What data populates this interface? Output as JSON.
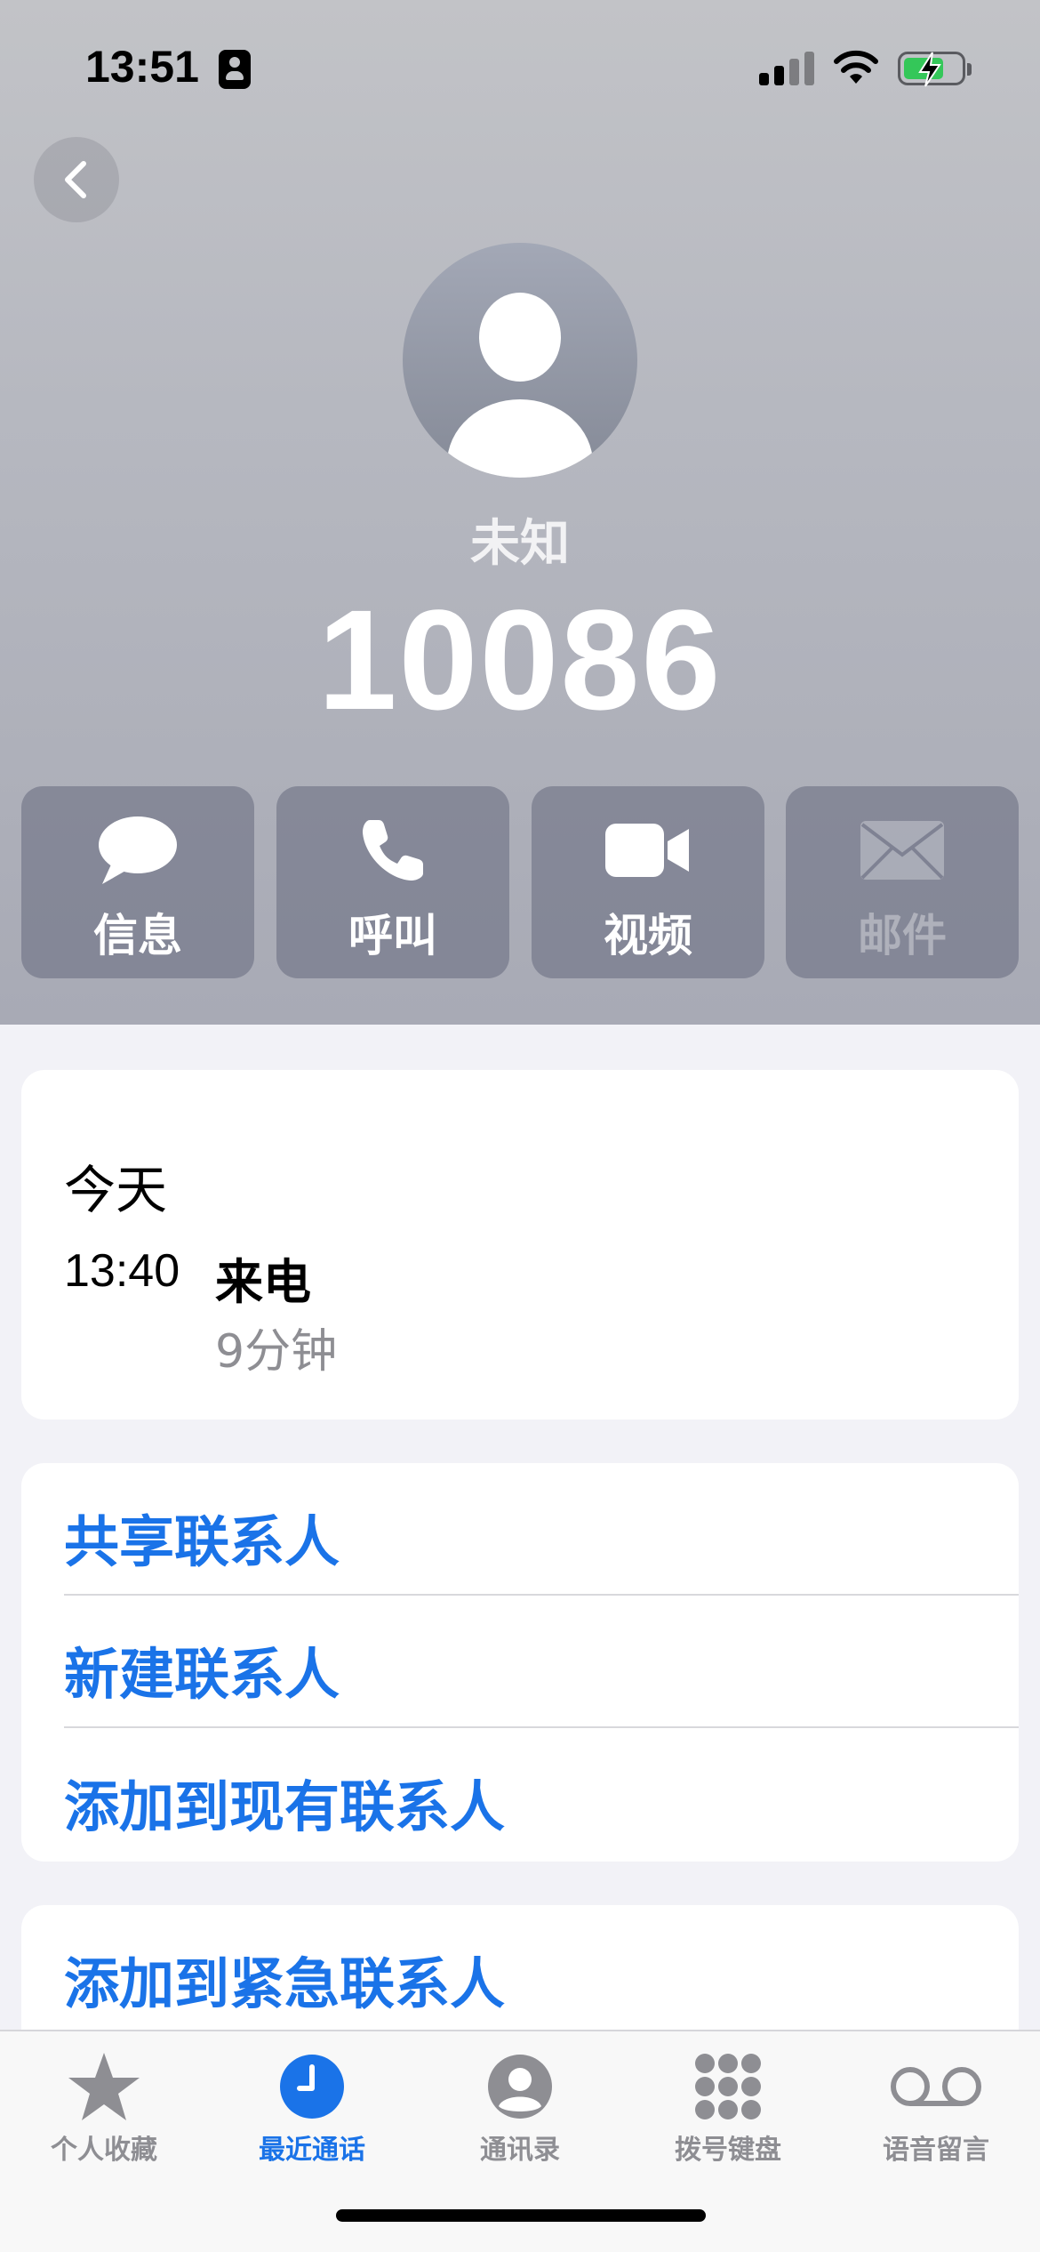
{
  "status_bar": {
    "time": "13:51"
  },
  "contact": {
    "label": "未知",
    "number": "10086"
  },
  "actions": [
    {
      "label": "信息",
      "icon": "message-bubble-icon",
      "enabled": true
    },
    {
      "label": "呼叫",
      "icon": "phone-icon",
      "enabled": true
    },
    {
      "label": "视频",
      "icon": "video-camera-icon",
      "enabled": true
    },
    {
      "label": "邮件",
      "icon": "envelope-icon",
      "enabled": false
    }
  ],
  "call_history": {
    "day": "今天",
    "time": "13:40",
    "type": "来电",
    "duration": "9分钟"
  },
  "links": [
    "共享联系人",
    "新建联系人",
    "添加到现有联系人"
  ],
  "emergency_link": "添加到紧急联系人",
  "tab_bar": {
    "items": [
      {
        "label": "个人收藏",
        "icon": "star-icon",
        "active": false
      },
      {
        "label": "最近通话",
        "icon": "clock-icon",
        "active": true
      },
      {
        "label": "通讯录",
        "icon": "person-circle-icon",
        "active": false
      },
      {
        "label": "拨号键盘",
        "icon": "keypad-icon",
        "active": false
      },
      {
        "label": "语音留言",
        "icon": "voicemail-icon",
        "active": false
      }
    ]
  },
  "colors": {
    "accent": "#1a73e8",
    "battery": "#34c759"
  }
}
